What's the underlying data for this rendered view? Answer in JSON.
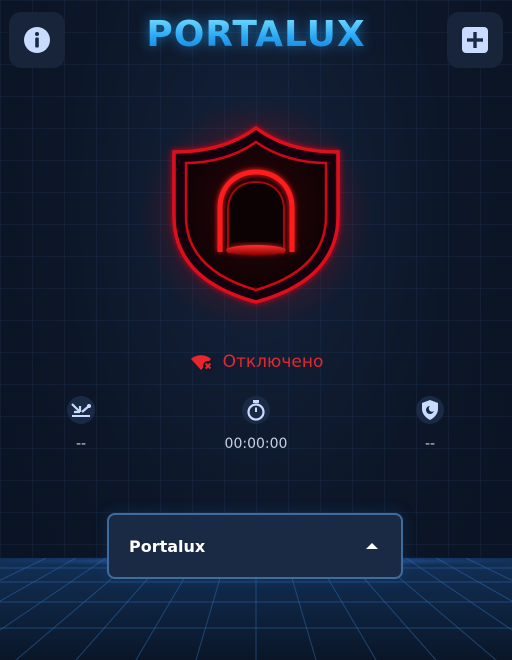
{
  "header": {
    "brand": "PORTALUX",
    "info_icon": "info-icon",
    "add_icon": "plus-square-icon"
  },
  "connection": {
    "status": "Отключено",
    "status_icon": "wifi-disconnected-icon",
    "state_icon": "shield-portal-icon"
  },
  "stats": [
    {
      "icon": "download-speed-icon",
      "value": "--"
    },
    {
      "icon": "stopwatch-icon",
      "value": "00:00:00"
    },
    {
      "icon": "shield-moon-icon",
      "value": "--"
    }
  ],
  "server_selector": {
    "label": "Portalux",
    "icon": "caret-up-icon"
  },
  "colors": {
    "accent": "#33bfff",
    "disconnected": "#e8262e",
    "background": "#0b1526"
  }
}
